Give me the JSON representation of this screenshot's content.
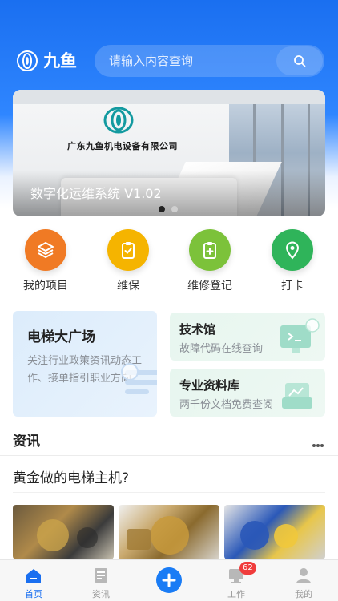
{
  "header": {
    "brand": "九鱼",
    "search_placeholder": "请输入内容查询"
  },
  "banner": {
    "company_name": "广东九鱼机电设备有限公司",
    "caption": "数字化运维系统 V1.02",
    "slide_count": 2,
    "active_slide": 1
  },
  "quick_actions": [
    {
      "label": "我的项目",
      "icon": "layers-icon",
      "color": "#f07a24"
    },
    {
      "label": "维保",
      "icon": "clipboard-check-icon",
      "color": "#f5b400"
    },
    {
      "label": "维修登记",
      "icon": "clipboard-plus-icon",
      "color": "#7cc23a"
    },
    {
      "label": "打卡",
      "icon": "location-pin-icon",
      "color": "#2fb45a"
    }
  ],
  "cards": {
    "elevator_plaza": {
      "title": "电梯大广场",
      "desc": "关注行业政策资讯动态工作、接单指引职业方向"
    },
    "tech_hall": {
      "title": "技术馆",
      "desc": "故障代码在线查询"
    },
    "library": {
      "title": "专业资料库",
      "desc": "两千份文档免费查阅"
    }
  },
  "news": {
    "section_title": "资讯",
    "headline": "黄金做的电梯主机?"
  },
  "tabbar": {
    "items": [
      {
        "label": "首页",
        "icon": "home-icon",
        "active": true
      },
      {
        "label": "资讯",
        "icon": "news-icon",
        "active": false
      },
      {
        "label": "",
        "icon": "plus-icon",
        "active": false
      },
      {
        "label": "工作",
        "icon": "work-icon",
        "active": false,
        "badge": "62"
      },
      {
        "label": "我的",
        "icon": "user-icon",
        "active": false
      }
    ]
  },
  "colors": {
    "primary": "#1a6ff0",
    "badge": "#f03c3c"
  }
}
